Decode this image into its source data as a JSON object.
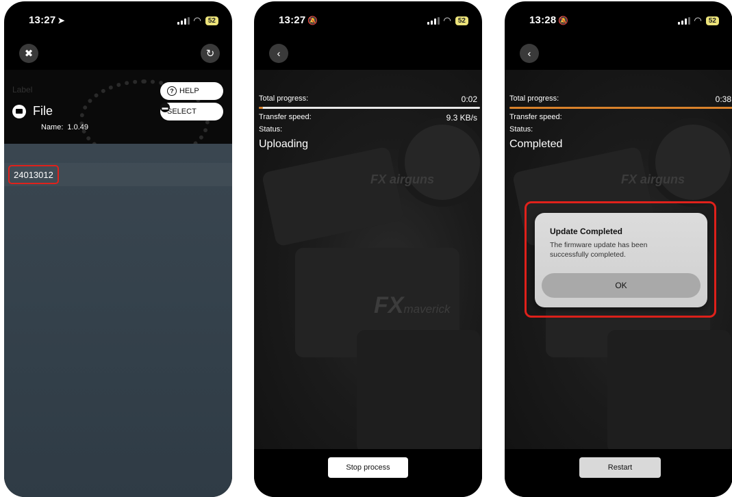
{
  "screen1": {
    "status_time": "13:27",
    "time_glyph": "➤",
    "battery": "52",
    "label_text": "Label",
    "file_title": "File",
    "name_label": "Name:",
    "name_value": "1.0.49",
    "help_label": "HELP",
    "select_label": "SELECT",
    "list_items": [
      "24013012"
    ]
  },
  "screen2": {
    "status_time": "13:27",
    "battery": "52",
    "total_progress_label": "Total progress:",
    "total_progress_time": "0:02",
    "progress_fraction": 0.02,
    "transfer_speed_label": "Transfer speed:",
    "transfer_speed_value": "9.3 KB/s",
    "status_label": "Status:",
    "status_value": "Uploading",
    "stop_button": "Stop process",
    "watermark_small": "FX airguns",
    "watermark_big": "FX",
    "watermark_big_sub": "maverick"
  },
  "screen3": {
    "status_time": "13:28",
    "battery": "52",
    "total_progress_label": "Total progress:",
    "total_progress_time": "0:38",
    "progress_fraction": 1.0,
    "progress_color": "#d9822b",
    "transfer_speed_label": "Transfer speed:",
    "status_label": "Status:",
    "status_value": "Completed",
    "dialog_title": "Update Completed",
    "dialog_message": "The firmware update has been successfully completed.",
    "dialog_ok": "OK",
    "restart_button": "Restart"
  },
  "colors": {
    "highlight_red": "#e0211b",
    "accent_orange": "#d9822b"
  }
}
